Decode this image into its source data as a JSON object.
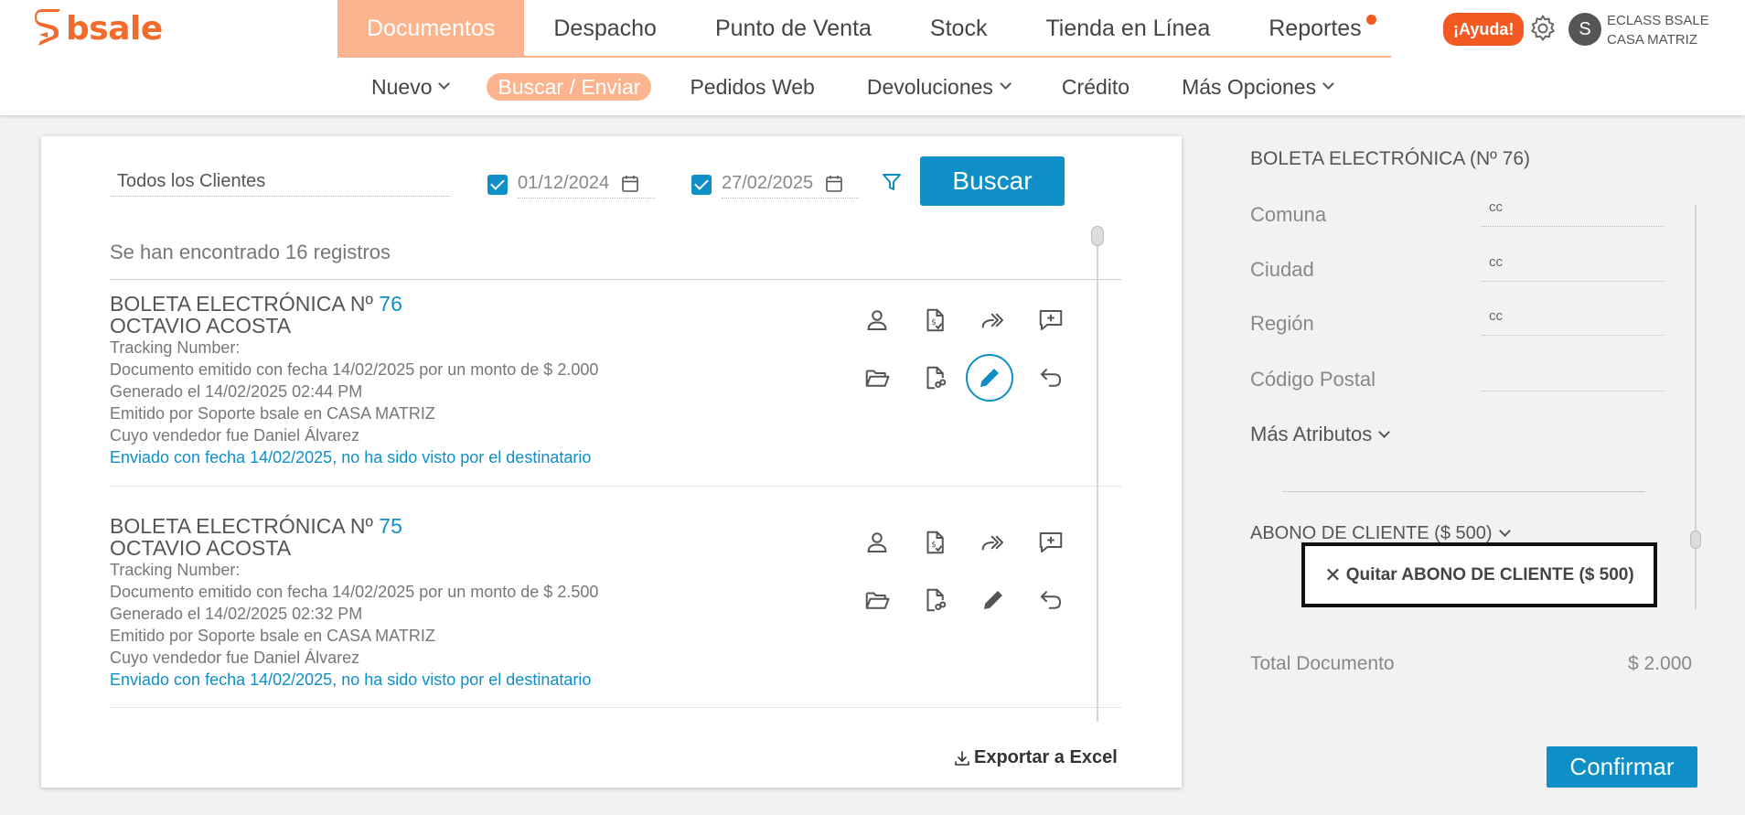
{
  "app": {
    "logo_text": "bsale",
    "brand_color": "#f26b2a",
    "accent_color": "#0e8fc7"
  },
  "nav": {
    "items": [
      {
        "label": "Documentos",
        "active": true
      },
      {
        "label": "Despacho"
      },
      {
        "label": "Punto de Venta"
      },
      {
        "label": "Stock"
      },
      {
        "label": "Tienda en Línea"
      },
      {
        "label": "Reportes",
        "notification": true
      }
    ],
    "help_label": "¡Ayuda!",
    "avatar_letter": "S",
    "user_name": "ECLASS BSALE",
    "user_branch": "CASA MATRIZ"
  },
  "subnav": {
    "items": [
      {
        "label": "Nuevo",
        "dropdown": true
      },
      {
        "label": "Buscar / Enviar",
        "active": true
      },
      {
        "label": "Pedidos Web"
      },
      {
        "label": "Devoluciones",
        "dropdown": true
      },
      {
        "label": "Crédito"
      },
      {
        "label": "Más Opciones",
        "dropdown": true
      }
    ]
  },
  "filters": {
    "client": "Todos los Clientes",
    "date_from": "01/12/2024",
    "date_to": "27/02/2025",
    "search_label": "Buscar"
  },
  "results": {
    "count_text": "Se han encontrado 16 registros",
    "docs": [
      {
        "title": "BOLETA ELECTRÓNICA Nº",
        "number": "76",
        "client": "OCTAVIO ACOSTA",
        "tracking": "Tracking Number:",
        "emitted": "Documento emitido con fecha 14/02/2025 por un monto de $ 2.000",
        "generated": "Generado el 14/02/2025 02:44 PM",
        "issuer": "Emitido por Soporte bsale en CASA MATRIZ",
        "seller": "Cuyo vendedor fue Daniel Álvarez",
        "sent": "Enviado con fecha 14/02/2025, no ha sido visto por el destinatario"
      },
      {
        "title": "BOLETA ELECTRÓNICA Nº",
        "number": "75",
        "client": "OCTAVIO ACOSTA",
        "tracking": "Tracking Number:",
        "emitted": "Documento emitido con fecha 14/02/2025 por un monto de $ 2.500",
        "generated": "Generado el 14/02/2025 02:32 PM",
        "issuer": "Emitido por Soporte bsale en CASA MATRIZ",
        "seller": "Cuyo vendedor fue Daniel Álvarez",
        "sent": "Enviado con fecha 14/02/2025, no ha sido visto por el destinatario"
      }
    ],
    "export_label": "Exportar a Excel"
  },
  "detail": {
    "title": "BOLETA ELECTRÓNICA (Nº 76)",
    "fields": [
      {
        "label": "Comuna",
        "value": "cc"
      },
      {
        "label": "Ciudad",
        "value": "cc"
      },
      {
        "label": "Región",
        "value": "cc"
      },
      {
        "label": "Código Postal",
        "value": ""
      }
    ],
    "more_label": "Más Atributos",
    "abono_label": "ABONO DE CLIENTE ($ 500)",
    "remove_label": "Quitar ABONO DE CLIENTE ($ 500)",
    "total_label": "Total Documento",
    "total_value": "$ 2.000",
    "confirm_label": "Confirmar"
  }
}
